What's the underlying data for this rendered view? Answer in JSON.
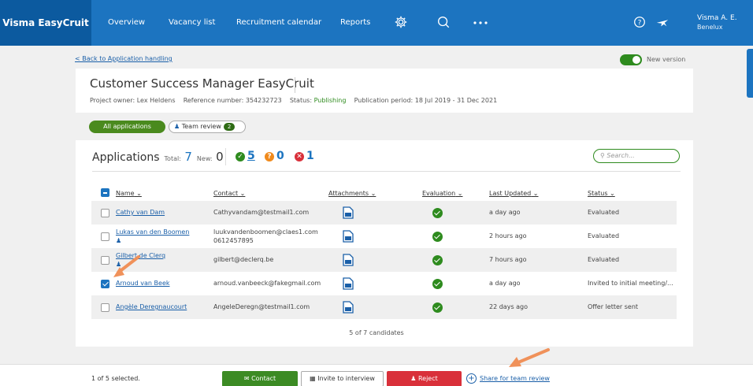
{
  "colors": {
    "nav": "#1c74c0",
    "brand": "#0c5a9f",
    "accent_green": "#2e8b1e",
    "reject_red": "#d9303a",
    "link": "#1a5fa8"
  },
  "nav": {
    "brand": "Visma EasyCruit",
    "items": [
      "Overview",
      "Vacancy list",
      "Recruitment calendar",
      "Reports"
    ],
    "icons": [
      "gear-icon",
      "search-icon",
      "more-icon",
      "help-icon",
      "plane-icon"
    ],
    "user_name": "Visma A. E.",
    "user_sub": "Benelux"
  },
  "page": {
    "back_link": "< Back to Application handling",
    "toggle_label": "New version",
    "job_title": "Customer Success Manager EasyCruit",
    "meta": {
      "owner_label": "Project owner:",
      "owner": "Lex Heldens",
      "ref_label": "Reference number:",
      "ref": "354232723",
      "status_label": "Status:",
      "status": "Publishing",
      "period_label": "Publication period:",
      "period": "18 Jul 2019 - 31 Dec 2021"
    },
    "filters": {
      "all": "All applications",
      "team": "Team review",
      "team_count": "2"
    }
  },
  "applications": {
    "title": "Applications",
    "total_label": "Total:",
    "total": "7",
    "new_label": "New:",
    "new": "0",
    "approved": "5",
    "maybe": "0",
    "rejected": "1",
    "search_placeholder": "Search...",
    "columns": [
      "Name",
      "Contact",
      "Attachments",
      "Evaluation",
      "Last Updated",
      "Status"
    ],
    "rows": [
      {
        "name": "Cathy van Dam",
        "contact": "Cathyvandam@testmail1.com",
        "contact2": "",
        "updated": "a day ago",
        "status": "Evaluated",
        "checked": false,
        "team": false
      },
      {
        "name": "Lukas van den Boomen",
        "contact": "luukvandenboomen@claes1.com",
        "contact2": "0612457895",
        "updated": "2 hours ago",
        "status": "Evaluated",
        "checked": false,
        "team": true
      },
      {
        "name": "Gilbert de Clerq",
        "contact": "gilbert@declerq.be",
        "contact2": "",
        "updated": "7 hours ago",
        "status": "Evaluated",
        "checked": false,
        "team": true
      },
      {
        "name": "Arnoud van Beek",
        "contact": "arnoud.vanbeeck@fakegmail.com",
        "contact2": "",
        "updated": "a day ago",
        "status": "Invited to initial meeting/...",
        "checked": true,
        "team": false
      },
      {
        "name": "Angèle Deregnaucourt",
        "contact": "AngeleDeregn@testmail1.com",
        "contact2": "",
        "updated": "22 days ago",
        "status": "Offer letter sent",
        "checked": false,
        "team": false
      }
    ],
    "pager": "5 of 7 candidates"
  },
  "bottom": {
    "selected": "1 of 5 selected.",
    "contact": "Contact",
    "invite": "Invite to interview",
    "reject": "Reject",
    "share": "Share for team review"
  }
}
